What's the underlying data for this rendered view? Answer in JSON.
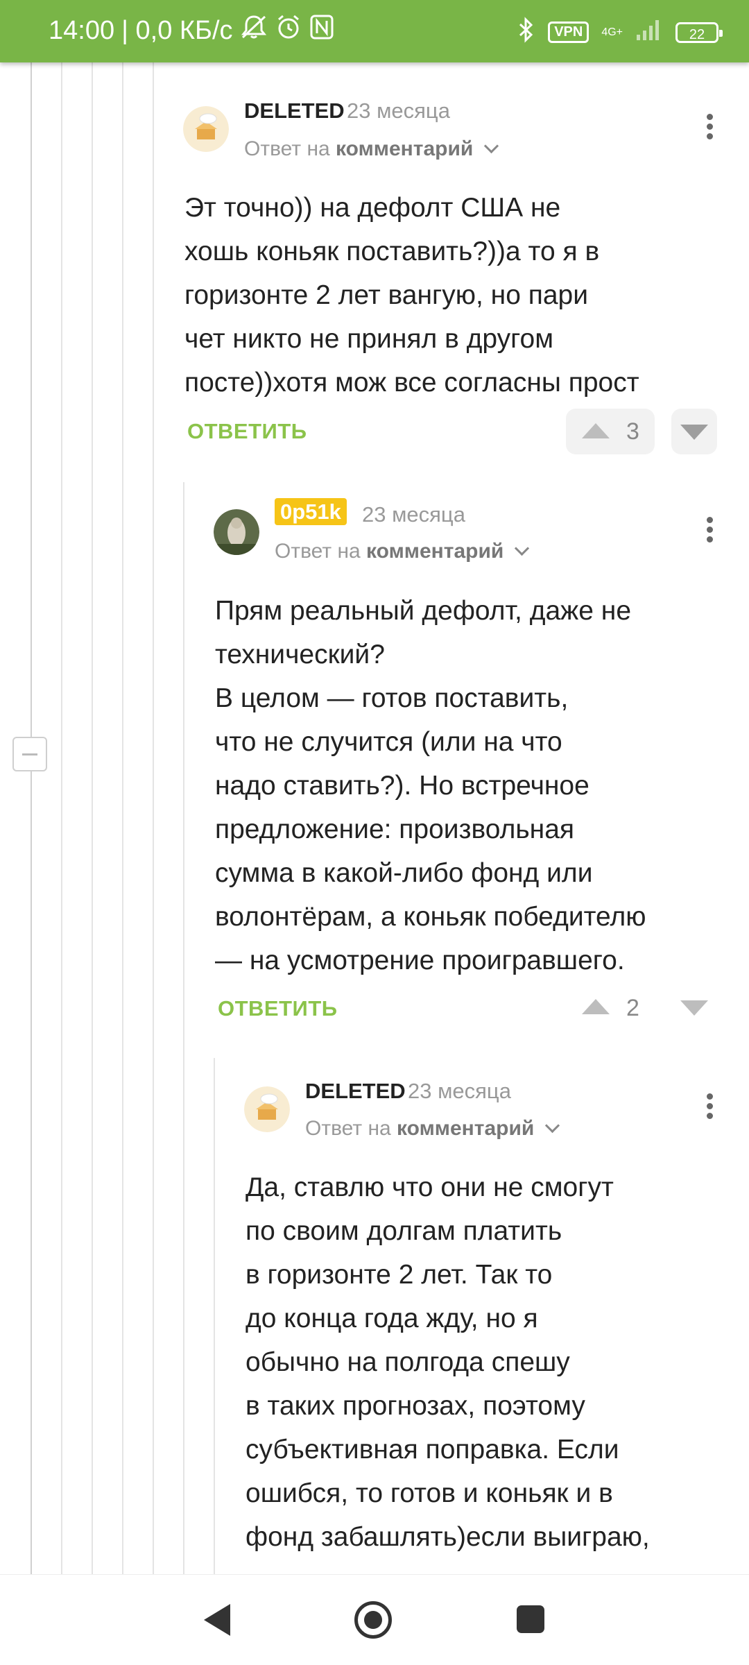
{
  "status_bar": {
    "time": "14:00",
    "network_speed": "| 0,0 КБ/с",
    "vpn": "VPN",
    "network_type": "4G+",
    "battery": "22",
    "icons": [
      "mute-icon",
      "alarm-icon",
      "nfc-icon",
      "bluetooth-icon",
      "signal-icon"
    ]
  },
  "comments": [
    {
      "author": "DELETED",
      "time": "23 месяца",
      "reply_to_prefix": "Ответ на",
      "reply_to_link": "комментарий",
      "lines": [
        "Эт точно)) на дефолт США не",
        "хошь коньяк поставить?))а то я в",
        "горизонте 2 лет вангую, но пари",
        "чет никто не принял в другом",
        "посте))хотя мож все согласны прост"
      ],
      "reply_label": "ОТВЕТИТЬ",
      "score": "3"
    },
    {
      "author": "0p51k",
      "time": "23 месяца",
      "reply_to_prefix": "Ответ на",
      "reply_to_link": "комментарий",
      "lines": [
        "Прям реальный дефолт, даже не",
        "технический?",
        "В целом — готов поставить,",
        "что не случится (или на что",
        "надо ставить?). Но встречное",
        "предложение: произвольная",
        "сумма в какой-либо фонд или",
        "волонтёрам, а коньяк победителю",
        "— на усмотрение проигравшего."
      ],
      "reply_label": "ОТВЕТИТЬ",
      "score": "2"
    },
    {
      "author": "DELETED",
      "time": "23 месяца",
      "reply_to_prefix": "Ответ на",
      "reply_to_link": "комментарий",
      "lines": [
        "Да, ставлю что они не смогут",
        "по своим долгам платить",
        "в горизонте 2 лет. Так то",
        "до конца года жду, но я",
        "обычно на полгода спешу",
        "в таких прогнозах, поэтому",
        "субъективная поправка. Если",
        "ошибся, то готов и коньяк и в",
        "фонд забашлять)если выиграю,"
      ]
    }
  ]
}
